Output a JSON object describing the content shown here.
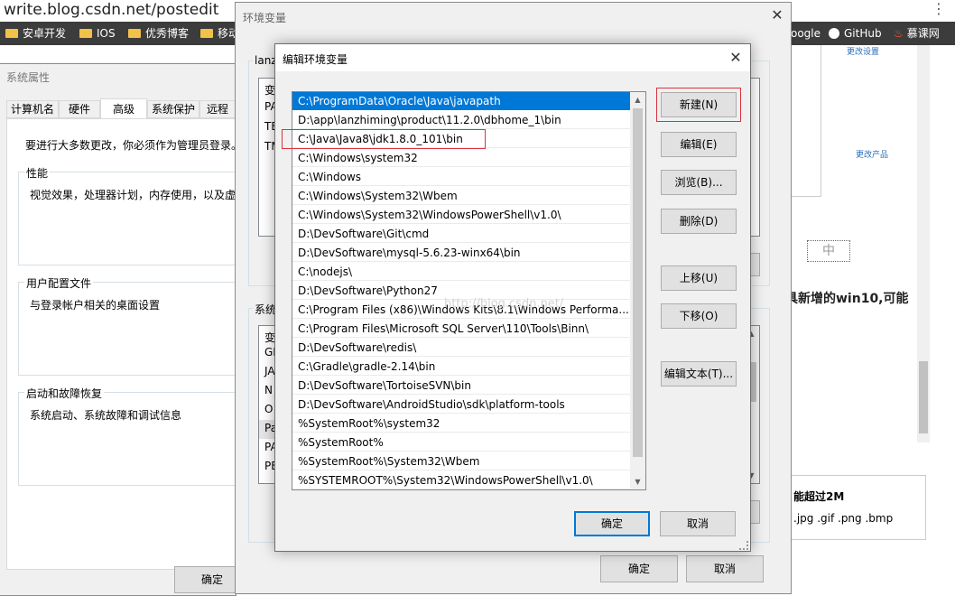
{
  "browser": {
    "url": "write.blog.csdn.net/postedit",
    "bookmarks": [
      {
        "label": "安卓开发"
      },
      {
        "label": "IOS"
      },
      {
        "label": "优秀博客"
      },
      {
        "label": "移动"
      }
    ],
    "bookmarks_right": [
      {
        "label": "oogle"
      },
      {
        "label": "GitHub"
      },
      {
        "label": "慕课网"
      }
    ]
  },
  "blog_page": {
    "link1": "更改设置",
    "link2": "更改产品",
    "stamp": "中",
    "heading": "具新增的win10,可能",
    "upload_limit": "能超过2M",
    "formats": ".jpg .gif .png .bmp"
  },
  "system_properties": {
    "title": "系统属性",
    "tabs": [
      "计算机名",
      "硬件",
      "高级",
      "系统保护",
      "远程"
    ],
    "active_tab": "高级",
    "admin_note": "要进行大多数更改，你必须作为管理员登录。",
    "performance_label": "性能",
    "performance_desc": "视觉效果，处理器计划，内存使用，以及虚",
    "profile_label": "用户配置文件",
    "profile_desc": "与登录帐户相关的桌面设置",
    "startup_label": "启动和故障恢复",
    "startup_desc": "系统启动、系统故障和调试信息",
    "ok": "确定"
  },
  "env_vars": {
    "title": "环境变量",
    "user_group_label": "lanz",
    "user_rows": [
      "变",
      "PA",
      "TE",
      "TM"
    ],
    "system_group_label": "系统",
    "system_rows": [
      "变",
      "GI",
      "JA",
      "N",
      "O",
      "Pa",
      "PA",
      "PE"
    ],
    "ok": "确定",
    "cancel": "取消"
  },
  "edit_env": {
    "title": "编辑环境变量",
    "entries": [
      "C:\\ProgramData\\Oracle\\Java\\javapath",
      "D:\\app\\lanzhiming\\product\\11.2.0\\dbhome_1\\bin",
      "C:\\Java\\Java8\\jdk1.8.0_101\\bin",
      "C:\\Windows\\system32",
      "C:\\Windows",
      "C:\\Windows\\System32\\Wbem",
      "C:\\Windows\\System32\\WindowsPowerShell\\v1.0\\",
      "D:\\DevSoftware\\Git\\cmd",
      "D:\\DevSoftware\\mysql-5.6.23-winx64\\bin",
      "C:\\nodejs\\",
      "D:\\DevSoftware\\Python27",
      "C:\\Program Files (x86)\\Windows Kits\\8.1\\Windows Performa...",
      "C:\\Program Files\\Microsoft SQL Server\\110\\Tools\\Binn\\",
      "D:\\DevSoftware\\redis\\",
      "C:\\Gradle\\gradle-2.14\\bin",
      "D:\\DevSoftware\\TortoiseSVN\\bin",
      "D:\\DevSoftware\\AndroidStudio\\sdk\\platform-tools",
      "%SystemRoot%\\system32",
      "%SystemRoot%",
      "%SystemRoot%\\System32\\Wbem",
      "%SYSTEMROOT%\\System32\\WindowsPowerShell\\v1.0\\"
    ],
    "selected_index": 0,
    "highlighted_index": 2,
    "watermark": "http://blog.csdn.net/",
    "buttons": {
      "new": "新建(N)",
      "edit": "编辑(E)",
      "browse": "浏览(B)...",
      "delete": "删除(D)",
      "up": "上移(U)",
      "down": "下移(O)",
      "edit_text": "编辑文本(T)..."
    },
    "ok": "确定",
    "cancel": "取消"
  },
  "colors": {
    "selection": "#0078d7",
    "highlight_box": "#d9333f",
    "bookmark_bar": "#3c3c3c",
    "primary_button_border": "#0078d7"
  }
}
